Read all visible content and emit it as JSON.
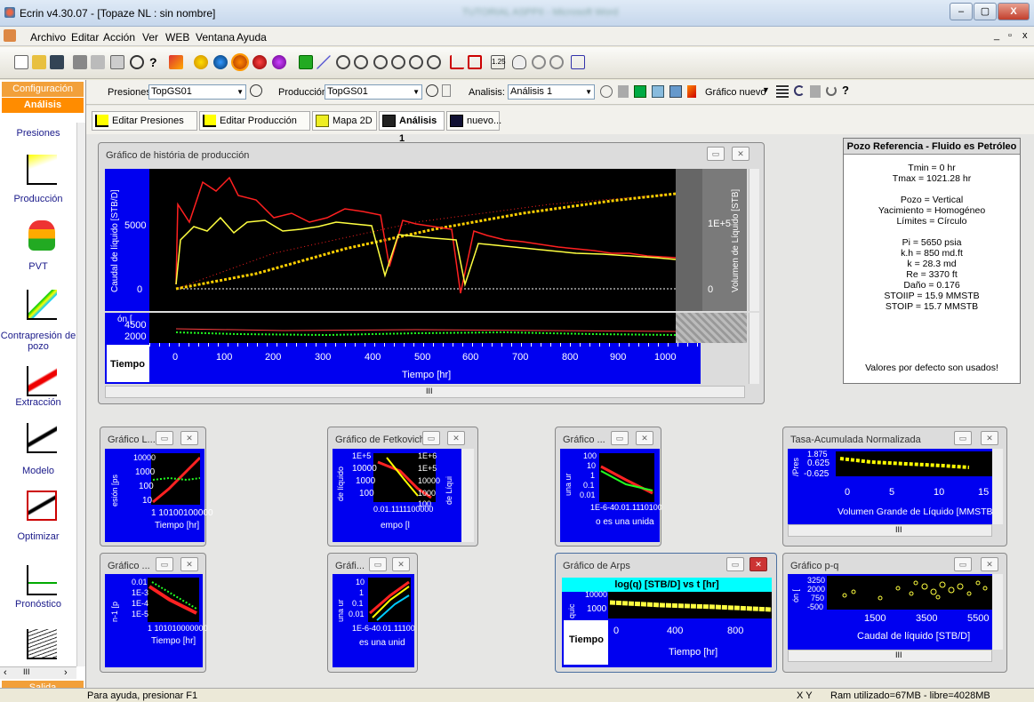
{
  "window": {
    "title": "Ecrin  v4.30.07 - [Topaze NL : sin nombre]",
    "blurred_title": "TUTORIAL ASPPII - Microsoft Word",
    "min": "–",
    "max": "▢",
    "close": "X"
  },
  "menu": [
    "Archivo",
    "Editar",
    "Acción",
    "Ver",
    "WEB",
    "Ventana",
    "Ayuda"
  ],
  "mdi_controls": [
    "_",
    "▫",
    "x"
  ],
  "sidebar": {
    "tabs": [
      "Configuración",
      "Análisis"
    ],
    "items": [
      "Presiones",
      "Producción",
      "PVT",
      "Contrapresión de pozo",
      "Extracción",
      "Modelo",
      "Optimizar",
      "Pronóstico"
    ],
    "bottom_tab": "Salida",
    "scroll_left": "‹",
    "scroll_mid": "III",
    "scroll_right": "›"
  },
  "controls": {
    "presiones_label": "Presiones:",
    "presiones_value": "TopGS01",
    "produccion_label": "Producción:",
    "produccion_value": "TopGS01",
    "analisis_label": "Analisis:",
    "analisis_value": "Análisis 1",
    "nuevo_grafico": "Gráfico nuevo"
  },
  "tabs": [
    "Editar Presiones",
    "Editar Producción",
    "Mapa 2D",
    "Análisis 1",
    "nuevo..."
  ],
  "main_plot": {
    "title": "Gráfico de história de producción",
    "ylabel_left": "Caudal de líquido [STB/D]",
    "ylabel_right": "Volumen de Líquido [STB]",
    "y_ticks_left": [
      "5000",
      "0"
    ],
    "y_ticks_right": [
      "1E+5",
      "0"
    ],
    "lower_ticks": [
      "4500",
      "2000"
    ],
    "lower_label": "ón [",
    "tiempo": "Tiempo",
    "x_ticks": [
      "0",
      "100",
      "200",
      "300",
      "400",
      "500",
      "600",
      "700",
      "800",
      "900",
      "1000"
    ],
    "xlabel": "Tiempo [hr]",
    "scroll": "III"
  },
  "info": {
    "header": "Pozo Referencia  -  Fluido es Petróleo",
    "lines": [
      "Tmin = 0 hr",
      "Tmax = 1021.28 hr",
      "",
      "Pozo = Vertical",
      "Yacimiento = Homogéneo",
      "Límites = Círculo",
      "",
      "Pi = 5650 psia",
      "k.h = 850 md.ft",
      "k = 28.3 md",
      "Re = 3370 ft",
      "Daño = 0.176",
      "STOIIP = 15.9 MMSTB",
      "STOIP = 15.7 MMSTB"
    ],
    "footer": "Valores por defecto son usados!"
  },
  "small_windows": [
    {
      "id": "w1",
      "title": "Gráfico L...",
      "ticks": [
        "10000",
        "1000",
        "100",
        "10"
      ],
      "xticks": "1  10100100000",
      "xlabel": "Tiempo [hr]",
      "ylabel": "esión [ps"
    },
    {
      "id": "w2",
      "title": "Gráfico de Fetkovich",
      "ticks": [
        "1E+5",
        "10000",
        "1000",
        "100"
      ],
      "ticks2": [
        "1E+6",
        "1E+5",
        "10000",
        "1000",
        "100"
      ],
      "xticks": "0.01.1111100000",
      "xlabel": "empo [l",
      "ylabel": "de líquido",
      "ylabel2": "de Líqui"
    },
    {
      "id": "w3",
      "title": "Gráfico ...",
      "ticks": [
        "100",
        "10",
        "1",
        "0.1",
        "0.01"
      ],
      "xticks": "1E-6-40.01.1110100",
      "xlabel": "o es una unida",
      "ylabel": "una ur"
    },
    {
      "id": "w4",
      "title": "Tasa-Acumulada Normalizada",
      "ticks": [
        "1.875",
        "0.625",
        "-0.625"
      ],
      "xticks": [
        "0",
        "5",
        "10",
        "15"
      ],
      "xlabel": "Volumen Grande de Líquido [MMSTB]",
      "ylabel": "/Pres",
      "scroll": "III"
    },
    {
      "id": "w5",
      "title": "Gráfico ...",
      "ticks": [
        "0.01",
        "1E-3",
        "1E-4",
        "1E-5"
      ],
      "xticks": "1  101010000000",
      "xlabel": "Tiempo [hr]",
      "ylabel": "n-1 [p"
    },
    {
      "id": "w6",
      "title": "Gráfi...",
      "ticks": [
        "10",
        "1",
        "0.1",
        "0.01"
      ],
      "xticks": "1E-6-40.01.11100",
      "xlabel": "es una unid",
      "ylabel": "una ur"
    },
    {
      "id": "w7",
      "title": "Gráfico de Arps",
      "banner": "log(q) [STB/D] vs t [hr]",
      "ticks": [
        "10000",
        "1000"
      ],
      "tiempo": "Tiempo",
      "xticks": [
        "0",
        "400",
        "800"
      ],
      "xlabel": "Tiempo [hr]",
      "ylabel": "quic"
    },
    {
      "id": "w8",
      "title": "Gráfico p-q",
      "ticks": [
        "3250",
        "2000",
        "750",
        "-500"
      ],
      "xticks": [
        "1500",
        "3500",
        "5500"
      ],
      "xlabel": "Caudal de líquido [STB/D]",
      "ylabel": "ón [",
      "scroll": "III"
    }
  ],
  "status": {
    "left": "Para ayuda, presionar F1",
    "xy": "X  Y",
    "right": "Ram utilizado=67MB - libre=4028MB"
  },
  "colors": {
    "plot_blue": "#0000f0",
    "red_series": "#ff2020",
    "yellow_series": "#ffff40",
    "sidebar_orange": "#ff8c00"
  }
}
